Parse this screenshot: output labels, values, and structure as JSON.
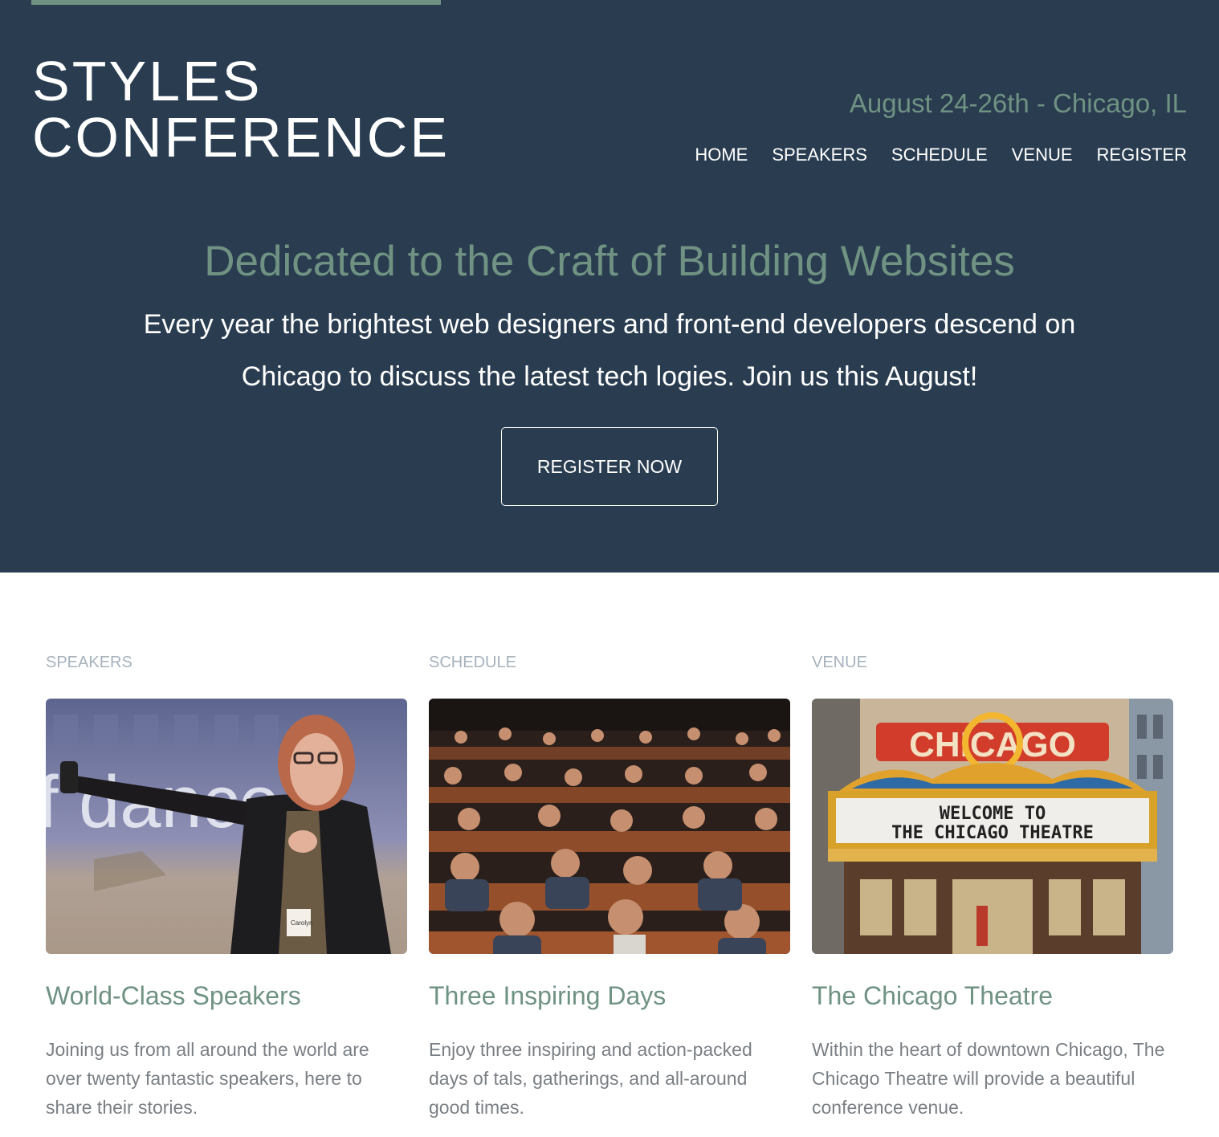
{
  "header": {
    "logo_line1": "STYLES",
    "logo_line2": "CONFERENCE",
    "tagline": "August 24-26th - Chicago, IL",
    "nav": [
      "HOME",
      "SPEAKERS",
      "SCHEDULE",
      "VENUE",
      "REGISTER"
    ]
  },
  "hero": {
    "headline": "Dedicated to the Craft of Building Websites",
    "intro": "Every year the brightest web designers and front-end developers descend on Chicago to discuss the latest tech logies. Join us this August!",
    "cta_label": "REGISTER NOW"
  },
  "columns": [
    {
      "label": "SPEAKERS",
      "title": "World-Class Speakers",
      "text": "Joining us from all around the world are over twenty fantastic speakers, here to share their stories."
    },
    {
      "label": "SCHEDULE",
      "title": "Three Inspiring Days",
      "text": "Enjoy three inspiring and action-packed days of tals, gatherings, and all-around good times."
    },
    {
      "label": "VENUE",
      "title": "The Chicago Theatre",
      "text": "Within the heart of downtown Chicago, The Chicago Theatre will provide a beautiful conference venue."
    }
  ],
  "photos": {
    "speaker_slide_text": "f dance",
    "badge_name": "Carolyn",
    "marquee_sign": "CHICAGO",
    "marquee_line1": "WELCOME TO",
    "marquee_line2": "THE CHICAGO THEATRE"
  },
  "colors": {
    "hero_bg": "#2a3d50",
    "accent": "#6f9283",
    "label_gray": "#a6b2bd",
    "body_gray": "#7a7f84"
  }
}
